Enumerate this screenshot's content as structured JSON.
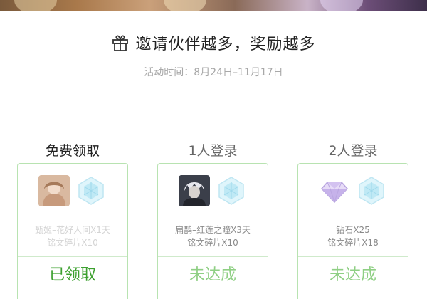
{
  "header": {
    "title": "邀请伙伴越多，奖励越多",
    "subtitle": "活动时间：8月24日–11月17日"
  },
  "cards": [
    {
      "heading": "免费领取",
      "reward_line1": "甄姬–花好人间X1天",
      "reward_line2": "铭文碎片X10",
      "status": "已领取"
    },
    {
      "heading": "1人登录",
      "reward_line1": "扁鹊–红莲之瞳X3天",
      "reward_line2": "铭文碎片X10",
      "status": "未达成"
    },
    {
      "heading": "2人登录",
      "reward_line1": "钻石X25",
      "reward_line2": "铭文碎片X18",
      "status": "未达成"
    }
  ],
  "icons": {
    "gift": "gift-icon",
    "skin_zhenji": "skin-avatar-icon",
    "skin_bianque": "skin-avatar-icon",
    "diamond": "diamond-icon",
    "crystal": "crystal-hexagon-icon"
  },
  "colors": {
    "accent_green": "#3ca02f",
    "pending_green": "#8fcf84",
    "card_border": "#b8e3b1",
    "muted_text": "#a8a8a8"
  }
}
